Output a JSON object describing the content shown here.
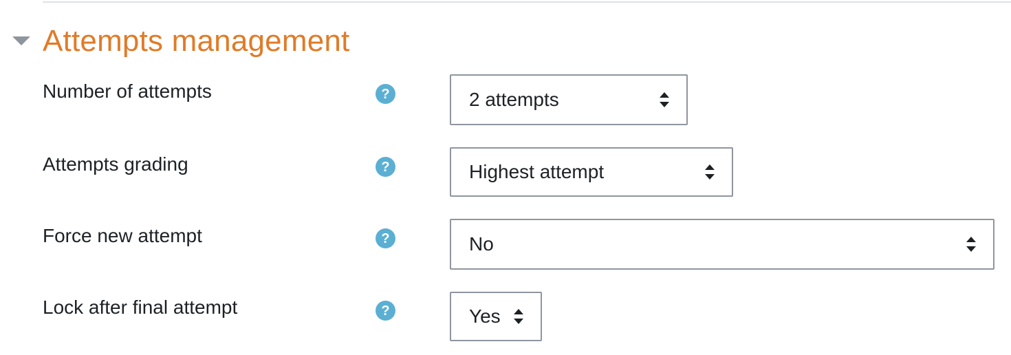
{
  "section": {
    "title": "Attempts management",
    "title_color": "#e07b28",
    "collapse_icon": "caret-down-icon"
  },
  "colors": {
    "help_icon": "#5bafd3",
    "caret_toggle": "#8f959e",
    "text": "#1d2125",
    "border": "#8f959e"
  },
  "rows": [
    {
      "label": "Number of attempts",
      "value": "2 attempts",
      "help_icon": "question-circle-icon"
    },
    {
      "label": "Attempts grading",
      "value": "Highest attempt",
      "help_icon": "question-circle-icon"
    },
    {
      "label": "Force new attempt",
      "value": "No",
      "help_icon": "question-circle-icon"
    },
    {
      "label": "Lock after final attempt",
      "value": "Yes",
      "help_icon": "question-circle-icon"
    }
  ]
}
